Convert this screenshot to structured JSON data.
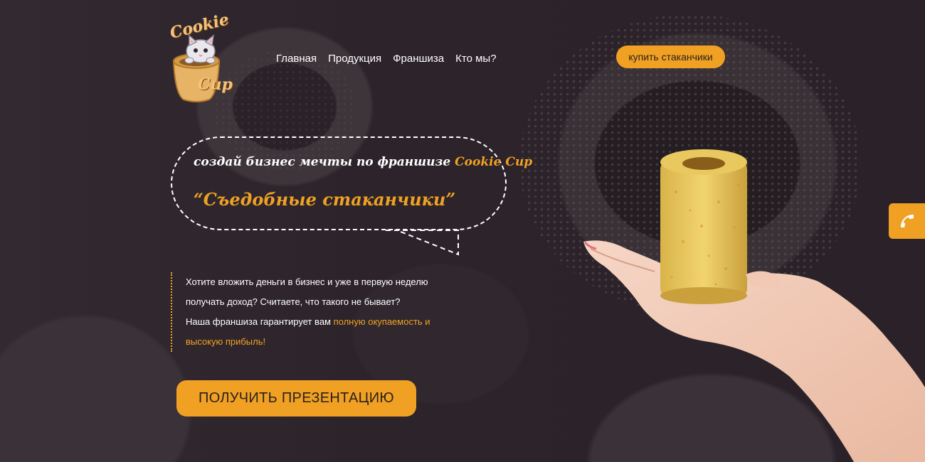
{
  "logo": {
    "line1": "Cookie",
    "line2": "Cup"
  },
  "nav": {
    "items": [
      {
        "label": "Главная"
      },
      {
        "label": "Продукция"
      },
      {
        "label": "Франшиза"
      },
      {
        "label": "Кто мы?"
      }
    ]
  },
  "header": {
    "buy_label": "купить стаканчики"
  },
  "hero": {
    "headline_prefix": "создай бизнес мечты по франшизе ",
    "headline_brand": "Cookie Cup",
    "slogan": "“Съедобные стаканчики”"
  },
  "description": {
    "line1": "Хотите вложить деньги в бизнес и уже в первую неделю",
    "line2": "получать доход? Считаете, что такого не бывает?",
    "line3_prefix": "Наша франшиза гарантирует вам ",
    "line3_accent": "полную окупаемость и",
    "line4_accent": "высокую прибыль!"
  },
  "cta": {
    "label": "ПОЛУЧИТЬ ПРЕЗЕНТАЦИЮ"
  },
  "colors": {
    "accent": "#f0a124",
    "background": "#2b2329",
    "text": "#ffffff"
  },
  "icons": {
    "phone": "phone-icon",
    "logo": "cat-cup-logo"
  }
}
